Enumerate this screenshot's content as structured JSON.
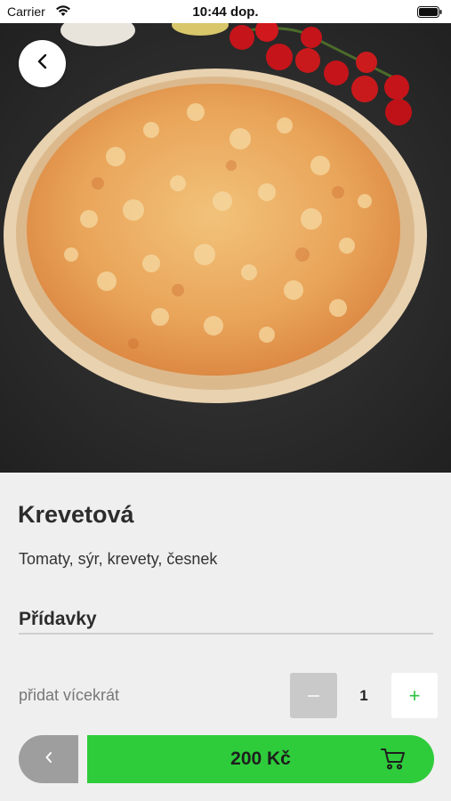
{
  "status_bar": {
    "carrier": "Carrier",
    "time": "10:44 dop."
  },
  "product": {
    "name": "Krevetová",
    "description": "Tomaty, sýr, krevety, česnek",
    "image": "pizza-photo"
  },
  "addons": {
    "heading": "Přídavky"
  },
  "quantity": {
    "label": "přidat vícekrát",
    "value": "1",
    "minus_icon": "minus-icon",
    "plus_label": "+"
  },
  "footer": {
    "back_icon": "chevron-left-icon",
    "price": "200 Kč",
    "cart_icon": "cart-icon"
  },
  "colors": {
    "accent_green": "#2ecc3b",
    "plus_green": "#2fc13e",
    "background": "#efefef",
    "disabled_gray": "#c9c9c9"
  }
}
